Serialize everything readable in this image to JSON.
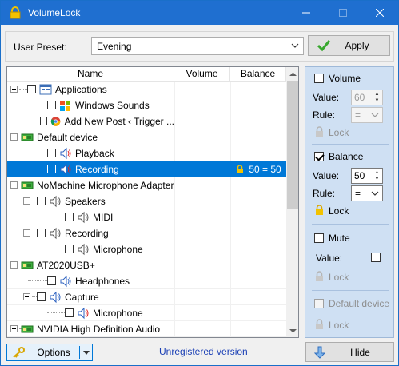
{
  "window": {
    "title": "VolumeLock"
  },
  "preset": {
    "label": "User Preset:",
    "value": "Evening",
    "apply_label": "Apply"
  },
  "tree": {
    "columns": [
      "Name",
      "Volume",
      "Balance"
    ],
    "rows": [
      {
        "label": "Applications",
        "balance": ""
      },
      {
        "label": "Windows Sounds",
        "balance": ""
      },
      {
        "label": "Add New Post ‹ Trigger ...",
        "balance": ""
      },
      {
        "label": "Default device",
        "balance": ""
      },
      {
        "label": "Playback",
        "balance": ""
      },
      {
        "label": "Recording",
        "balance": "50 = 50"
      },
      {
        "label": "NoMachine Microphone Adapter",
        "balance": ""
      },
      {
        "label": "Speakers",
        "balance": ""
      },
      {
        "label": "MIDI",
        "balance": ""
      },
      {
        "label": "Recording",
        "balance": ""
      },
      {
        "label": "Microphone",
        "balance": ""
      },
      {
        "label": "AT2020USB+",
        "balance": ""
      },
      {
        "label": "Headphones",
        "balance": ""
      },
      {
        "label": "Capture",
        "balance": ""
      },
      {
        "label": "Microphone",
        "balance": ""
      },
      {
        "label": "NVIDIA High Definition Audio",
        "balance": ""
      }
    ]
  },
  "panel": {
    "volume": {
      "label": "Volume",
      "value_label": "Value:",
      "value": "60",
      "rule_label": "Rule:",
      "rule": "=",
      "lock_label": "Lock"
    },
    "balance": {
      "label": "Balance",
      "value_label": "Value:",
      "value": "50",
      "rule_label": "Rule:",
      "rule": "=",
      "lock_label": "Lock"
    },
    "mute": {
      "label": "Mute",
      "value_label": "Value:",
      "lock_label": "Lock"
    },
    "default_device": {
      "label": "Default device",
      "lock_label": "Lock"
    }
  },
  "footer": {
    "options_label": "Options",
    "status": "Unregistered version",
    "hide_label": "Hide"
  },
  "colors": {
    "titlebar": "#1f6fd0",
    "selection": "#0078d7",
    "panel": "#cfe0f3",
    "status_text": "#1a3fb5"
  }
}
